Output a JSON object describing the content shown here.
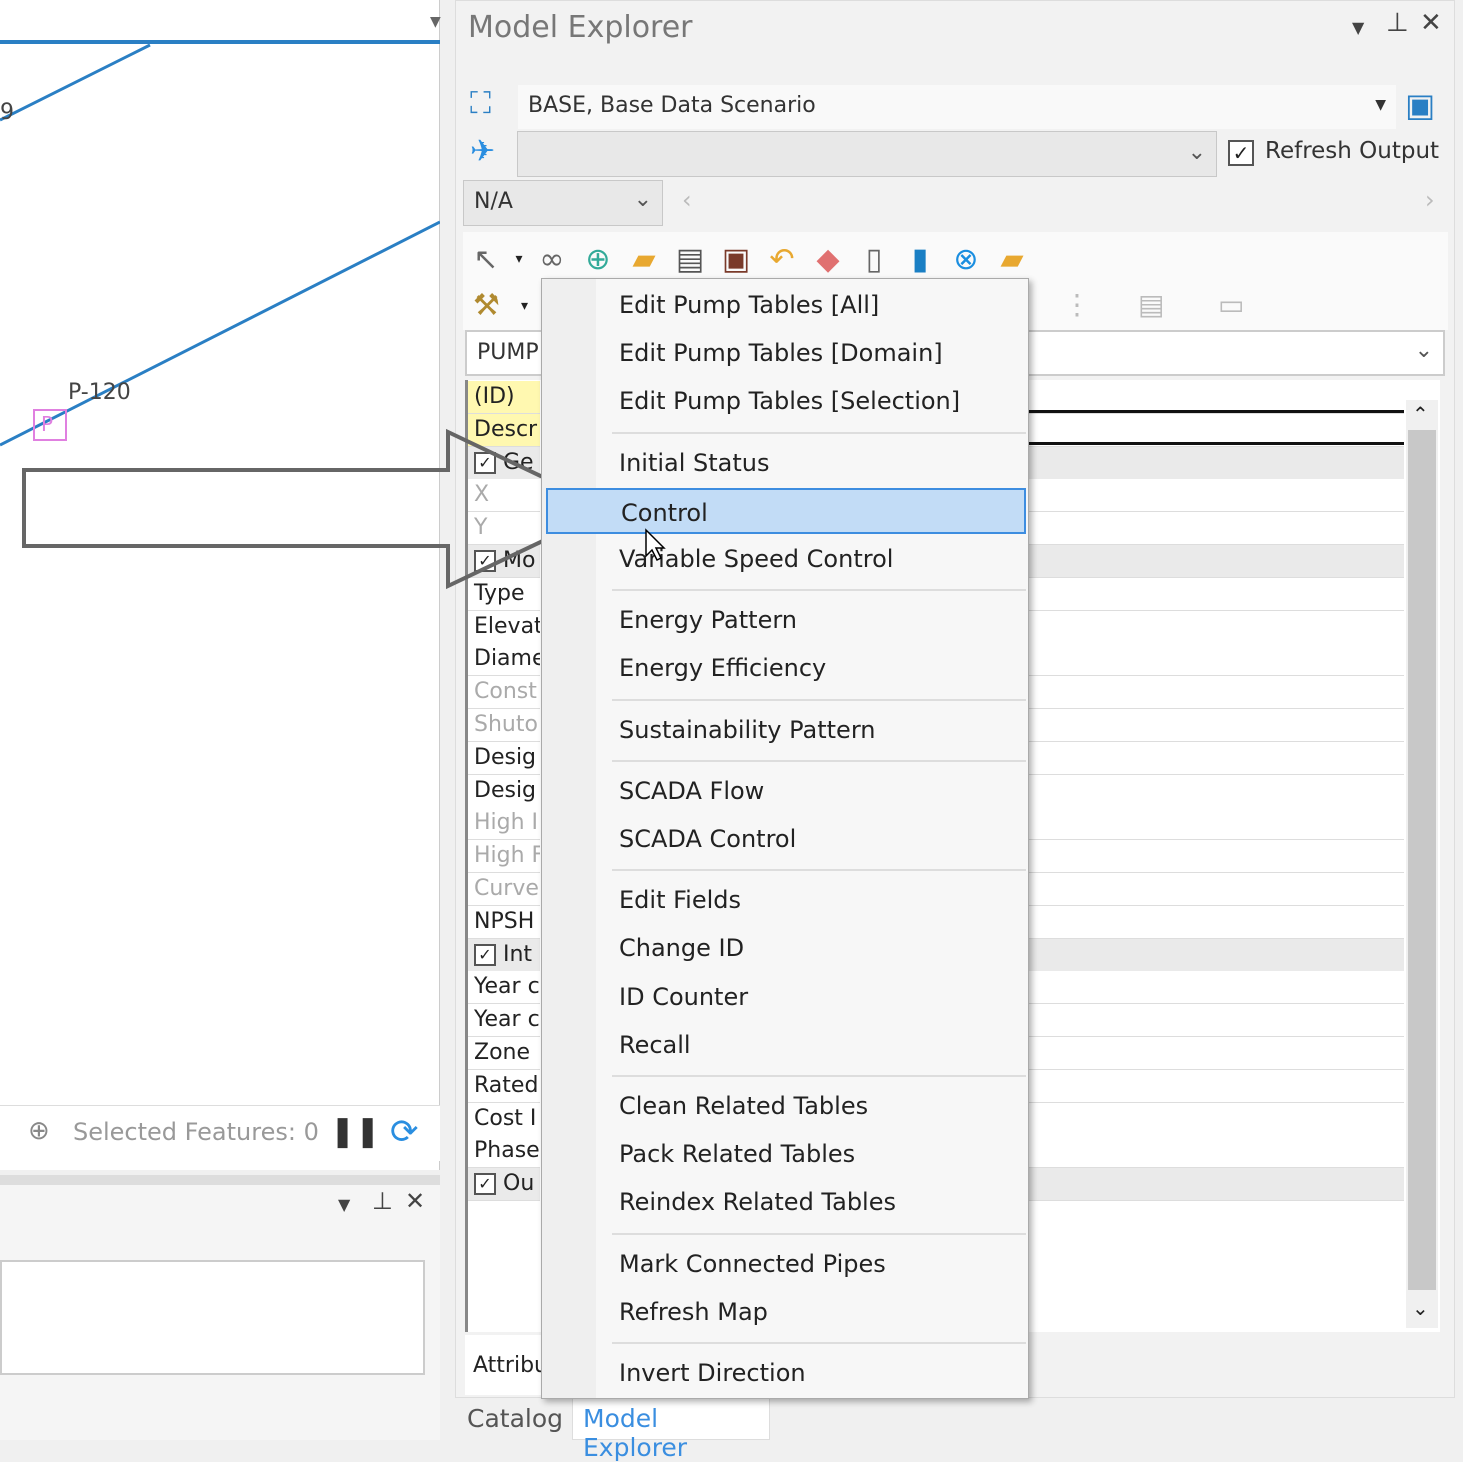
{
  "map": {
    "pipe_label": "P-120",
    "node_label": "P",
    "edge_label": "9"
  },
  "status_bar": {
    "selected_features": "Selected Features: 0"
  },
  "panel": {
    "title": "Model Explorer",
    "scenario": "BASE, Base Data Scenario",
    "secondary_combo": "",
    "refresh_output_label": "Refresh Output",
    "refresh_output_checked": true,
    "time_combo": "N/A",
    "element_combo": "PUMP:",
    "bottom_tab": "Attribu"
  },
  "attributes": [
    {
      "label": "(ID)",
      "style": "yel"
    },
    {
      "label": "Descr",
      "style": "yel"
    },
    {
      "label": "Ge",
      "style": "cat"
    },
    {
      "label": "X",
      "style": "dim"
    },
    {
      "label": "Y",
      "style": "dim"
    },
    {
      "label": "Mo",
      "style": "cat"
    },
    {
      "label": "Type",
      "style": ""
    },
    {
      "label": "Elevat",
      "style": ""
    },
    {
      "label": "Diame",
      "style": ""
    },
    {
      "label": "Const",
      "style": "dim"
    },
    {
      "label": "Shuto",
      "style": "dim"
    },
    {
      "label": "Desig",
      "style": ""
    },
    {
      "label": "Desig",
      "style": ""
    },
    {
      "label": "High I",
      "style": "dim"
    },
    {
      "label": "High F",
      "style": "dim"
    },
    {
      "label": "Curve",
      "style": "dim"
    },
    {
      "label": "NPSH",
      "style": ""
    },
    {
      "label": "Int",
      "style": "cat"
    },
    {
      "label": "Year c",
      "style": ""
    },
    {
      "label": "Year c",
      "style": ""
    },
    {
      "label": "Zone",
      "style": ""
    },
    {
      "label": "Rated",
      "style": ""
    },
    {
      "label": "Cost I",
      "style": ""
    },
    {
      "label": "Phase",
      "style": ""
    },
    {
      "label": "Ou",
      "style": "cat"
    }
  ],
  "context_menu": {
    "highlighted": "Control",
    "groups": [
      [
        "Edit Pump Tables [All]",
        "Edit Pump Tables [Domain]",
        "Edit Pump Tables [Selection]"
      ],
      [
        "Initial Status",
        "Control",
        "Variable Speed Control"
      ],
      [
        "Energy Pattern",
        "Energy Efficiency"
      ],
      [
        "Sustainability Pattern"
      ],
      [
        "SCADA Flow",
        "SCADA Control"
      ],
      [
        "Edit Fields",
        "Change ID",
        "ID Counter",
        "Recall"
      ],
      [
        "Clean Related Tables",
        "Pack Related Tables",
        "Reindex Related Tables"
      ],
      [
        "Mark Connected Pipes",
        "Refresh Map"
      ],
      [
        "Invert Direction"
      ]
    ]
  },
  "bottom_tabs": [
    {
      "label": "Catalog",
      "active": false
    },
    {
      "label": "Model Explorer",
      "active": true
    }
  ],
  "colors": {
    "accent": "#3d8de0",
    "highlight": "#c2dcf6",
    "pipe": "#2a7fc4",
    "id_field": "#fff8b0"
  }
}
